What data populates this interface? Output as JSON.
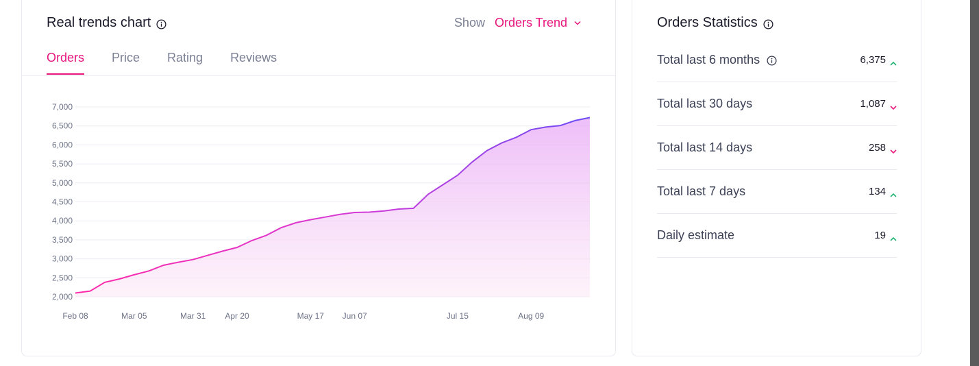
{
  "trend": {
    "title": "Real trends chart",
    "show_label": "Show",
    "show_value": "Orders Trend",
    "tabs": [
      {
        "label": "Orders",
        "active": true
      },
      {
        "label": "Price",
        "active": false
      },
      {
        "label": "Rating",
        "active": false
      },
      {
        "label": "Reviews",
        "active": false
      }
    ]
  },
  "stats": {
    "title": "Orders Statistics",
    "rows": [
      {
        "label": "Total last 6 months",
        "value": "6,375",
        "trend": "up",
        "info": true
      },
      {
        "label": "Total last 30 days",
        "value": "1,087",
        "trend": "down",
        "info": false
      },
      {
        "label": "Total last 14 days",
        "value": "258",
        "trend": "down",
        "info": false
      },
      {
        "label": "Total last 7 days",
        "value": "134",
        "trend": "up",
        "info": false
      },
      {
        "label": "Daily estimate",
        "value": "19",
        "trend": "up",
        "info": false
      }
    ]
  },
  "colors": {
    "accent": "#e8157c",
    "up": "#22b573",
    "down": "#e8157c",
    "line_start": "#ff2aa8",
    "line_end": "#6a4cf5"
  },
  "chart_data": {
    "type": "area",
    "title": "",
    "xlabel": "",
    "ylabel": "",
    "ylim": [
      2000,
      7000
    ],
    "y_ticks": [
      "2,000",
      "2,500",
      "3,000",
      "3,500",
      "4,000",
      "4,500",
      "5,000",
      "5,500",
      "6,000",
      "6,500",
      "7,000"
    ],
    "x_ticks": [
      "Feb 08",
      "Mar 05",
      "Mar 31",
      "Apr 20",
      "May 17",
      "Jun 07",
      "Jul 15",
      "Aug 09"
    ],
    "series": [
      {
        "name": "",
        "x": [
          "Feb 08",
          "Feb 14",
          "Feb 20",
          "Feb 26",
          "Mar 05",
          "Mar 12",
          "Mar 18",
          "Mar 24",
          "Mar 31",
          "Apr 06",
          "Apr 13",
          "Apr 20",
          "Apr 25",
          "Apr 30",
          "May 04",
          "May 10",
          "May 17",
          "May 24",
          "May 31",
          "Jun 07",
          "Jun 14",
          "Jun 21",
          "Jun 26",
          "Jul 01",
          "Jul 06",
          "Jul 10",
          "Jul 15",
          "Jul 20",
          "Jul 25",
          "Jul 30",
          "Aug 04",
          "Aug 09",
          "Aug 14",
          "Aug 19",
          "Aug 24",
          "Aug 27"
        ],
        "values": [
          2100,
          2150,
          2380,
          2470,
          2580,
          2680,
          2830,
          2910,
          2980,
          3090,
          3200,
          3300,
          3480,
          3620,
          3820,
          3950,
          4030,
          4100,
          4170,
          4220,
          4230,
          4260,
          4310,
          4330,
          4700,
          4950,
          5200,
          5550,
          5850,
          6050,
          6200,
          6400,
          6470,
          6510,
          6640,
          6720
        ]
      }
    ]
  }
}
